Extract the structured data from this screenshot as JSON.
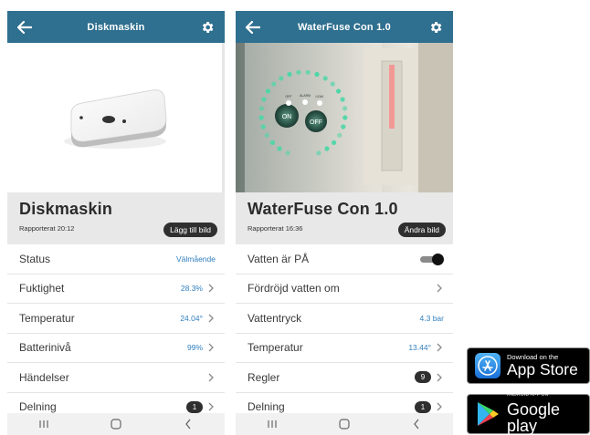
{
  "screens": [
    {
      "title": "Diskmaskin",
      "device_name": "Diskmaskin",
      "reported": "Rapporterat 20:12",
      "action_label": "Lägg till bild",
      "rows": [
        {
          "label": "Status",
          "value": "Välmående"
        },
        {
          "label": "Fuktighet",
          "value": "28.3%"
        },
        {
          "label": "Temperatur",
          "value": "24.04°"
        },
        {
          "label": "Batterinivå",
          "value": "99%"
        },
        {
          "label": "Händelser",
          "value": ""
        },
        {
          "label": "Delning",
          "badge": "1"
        }
      ]
    },
    {
      "title": "WaterFuse Con 1.0",
      "device_name": "WaterFuse Con 1.0",
      "reported": "Rapporterat 16:36",
      "action_label": "Ändra bild",
      "photo_labels": {
        "on": "ON",
        "off": "OFF",
        "off_small": "OFF",
        "alarm": "ALARM",
        "leak": "LEAK"
      },
      "rows": [
        {
          "label": "Vatten är PÅ",
          "toggle_on": true
        },
        {
          "label": "Fördröjd vatten om",
          "value": ""
        },
        {
          "label": "Vattentryck",
          "value": "4.3 bar"
        },
        {
          "label": "Temperatur",
          "value": "13.44°"
        },
        {
          "label": "Regler",
          "badge": "9"
        },
        {
          "label": "Delning",
          "badge": "1"
        }
      ]
    }
  ],
  "nav": {
    "recents_icon": "recent-apps-icon",
    "home_icon": "home-icon",
    "back_icon": "back-icon"
  },
  "badges": {
    "appstore": {
      "small": "Download on the",
      "big": "App Store"
    },
    "googleplay": {
      "small": "ANDROID APP ON",
      "big": "Google play"
    }
  },
  "colors": {
    "appbar": "#2f6f8f",
    "value_blue": "#2f7fbf",
    "panel_grey": "#e8e8e8",
    "led_green": "#4fd6a8"
  }
}
